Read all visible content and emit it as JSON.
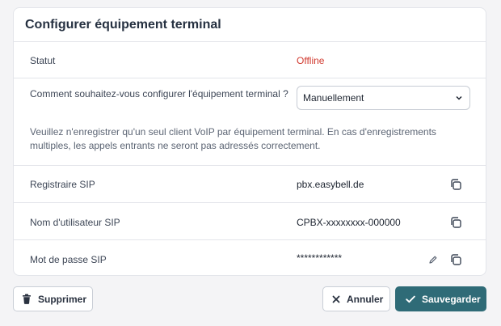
{
  "card": {
    "title": "Configurer équipement terminal"
  },
  "status": {
    "label": "Statut",
    "value": "Offline",
    "color": "#d13a2f"
  },
  "config": {
    "question": "Comment souhaitez-vous configurer l'équipement terminal ?",
    "selected": "Manuellement",
    "hint": "Veuillez n'enregistrer qu'un seul client VoIP par équipement terminal. En cas d'enregistrements multiples, les appels entrants ne seront pas adressés correctement."
  },
  "fields": {
    "registrar": {
      "label": "Registraire SIP",
      "value": "pbx.easybell.de"
    },
    "username": {
      "label": "Nom d'utilisateur SIP",
      "value": "CPBX-xxxxxxxx-000000"
    },
    "password": {
      "label": "Mot de passe SIP",
      "value": "************"
    }
  },
  "icons": {
    "copy": "copy-icon",
    "edit": "pencil-icon",
    "trash": "trash-icon",
    "close": "close-icon",
    "check": "check-icon",
    "chevron": "chevron-down-icon"
  },
  "buttons": {
    "delete": "Supprimer",
    "cancel": "Annuler",
    "save": "Sauvegarder"
  },
  "colors": {
    "primary": "#2f6b77",
    "offline": "#d13a2f"
  }
}
